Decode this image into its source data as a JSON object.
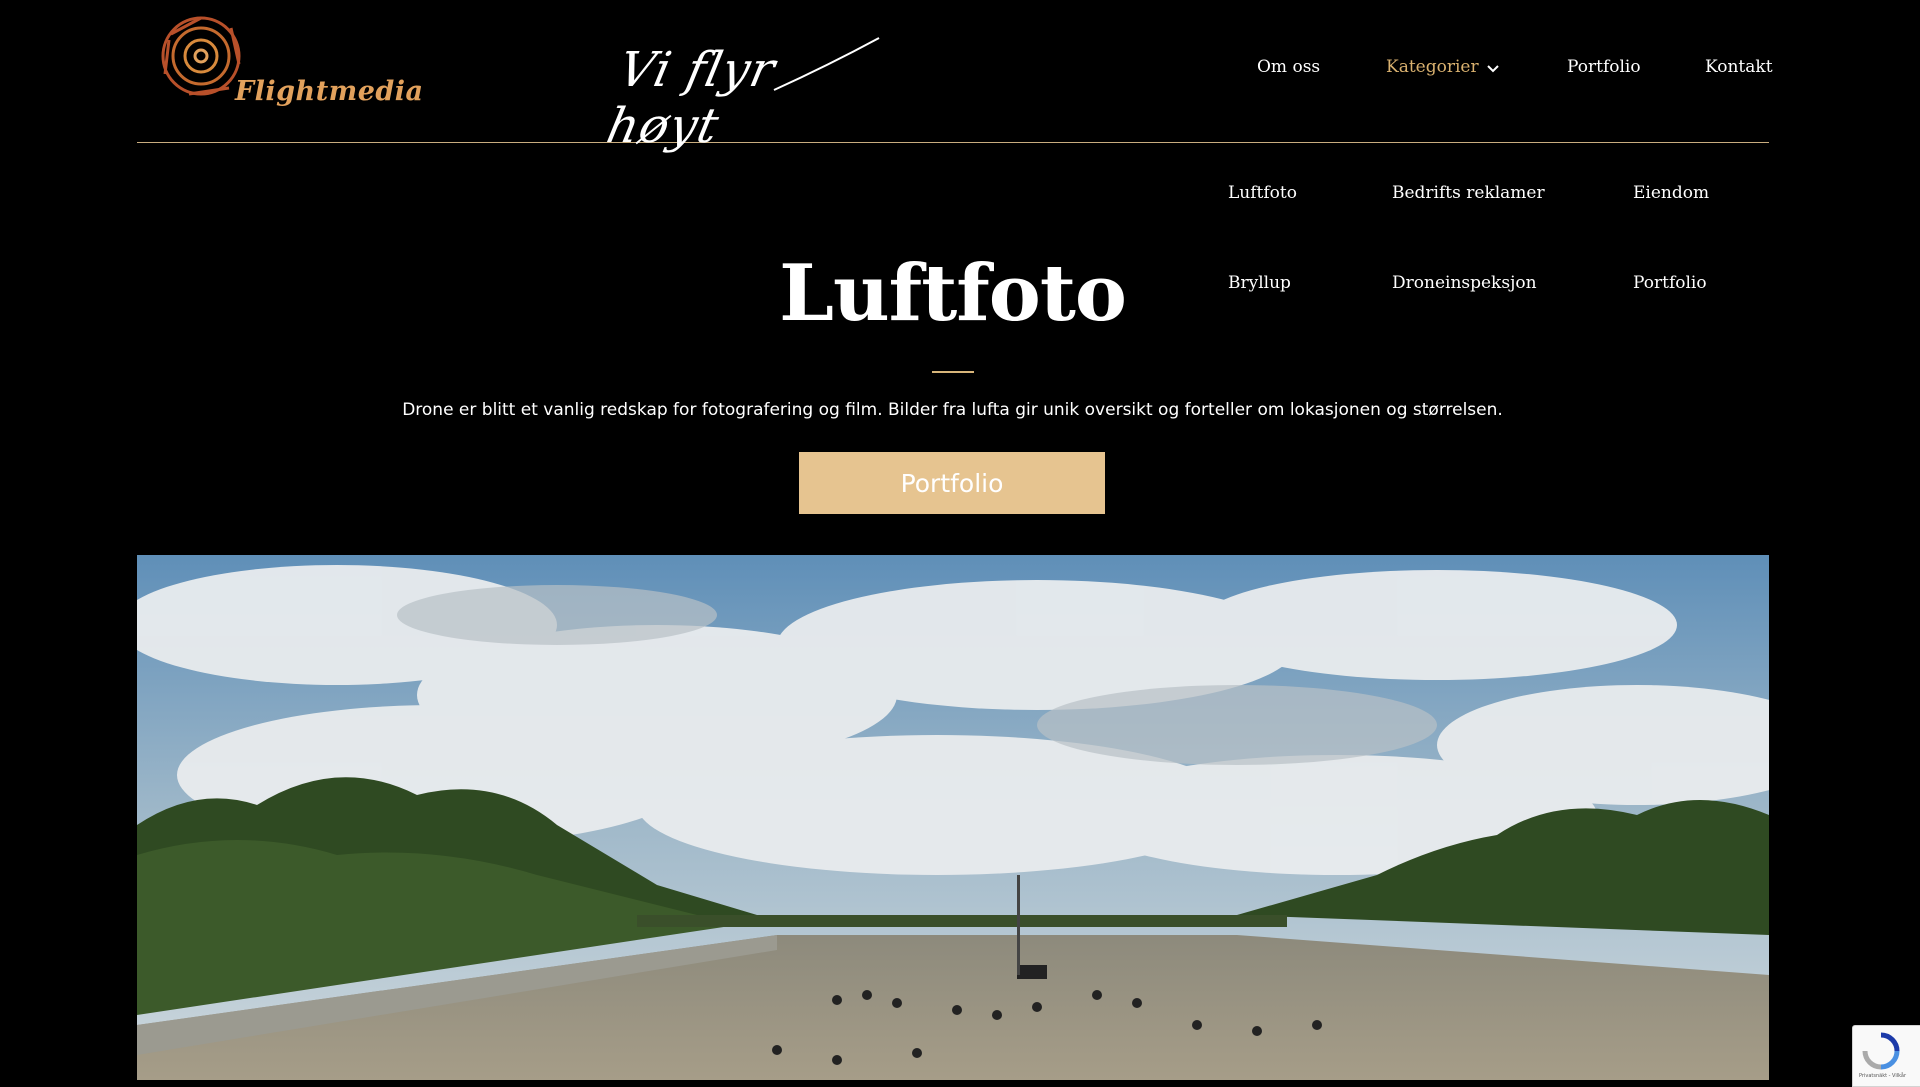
{
  "brand": {
    "logo_text": "Flightmedia",
    "slogan": "Vi flyr høyt"
  },
  "nav": {
    "om_oss": "Om oss",
    "kategorier": "Kategorier",
    "portfolio": "Portfolio",
    "kontakt": "Kontakt"
  },
  "submenu": [
    {
      "label": "Luftfoto"
    },
    {
      "label": "Bedrifts reklamer"
    },
    {
      "label": "Eiendom"
    },
    {
      "label": "Bryllup"
    },
    {
      "label": "Droneinspeksjon"
    },
    {
      "label": "Portfolio"
    }
  ],
  "hero": {
    "title": "Luftfoto",
    "description": "Drone er blitt et vanlig redskap for fotografering og film. Bilder fra lufta gir unik oversikt og forteller om lokasjonen og størrelsen.",
    "cta": "Portfolio"
  },
  "recaptcha": {
    "footer": "Privatsnäkt - Vilkår"
  },
  "colors": {
    "accent": "#d9b16f",
    "button": "#e6c490",
    "background": "#000000",
    "logo": "#e2a15c"
  },
  "icons": {
    "chevron": "chevron-down-icon",
    "logo": "camera-shutter-icon",
    "recaptcha": "recaptcha-icon"
  }
}
